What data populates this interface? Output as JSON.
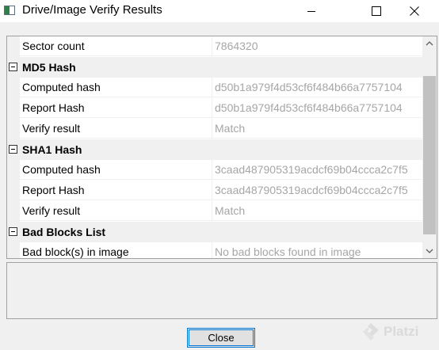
{
  "window": {
    "title": "Drive/Image Verify Results"
  },
  "rows": [
    {
      "kind": "property",
      "name": "Sector count",
      "value": "7864320"
    },
    {
      "kind": "category",
      "name": "MD5 Hash"
    },
    {
      "kind": "property",
      "name": "Computed hash",
      "value": "d50b1a979f4d53cf6f484b66a7757104"
    },
    {
      "kind": "property",
      "name": "Report Hash",
      "value": "d50b1a979f4d53cf6f484b66a7757104"
    },
    {
      "kind": "property",
      "name": "Verify result",
      "value": "Match"
    },
    {
      "kind": "category",
      "name": "SHA1 Hash"
    },
    {
      "kind": "property",
      "name": "Computed hash",
      "value": "3caad487905319acdcf69b04ccca2c7f5"
    },
    {
      "kind": "property",
      "name": "Report Hash",
      "value": "3caad487905319acdcf69b04ccca2c7f5"
    },
    {
      "kind": "property",
      "name": "Verify result",
      "value": "Match"
    },
    {
      "kind": "category",
      "name": "Bad Blocks List"
    },
    {
      "kind": "property",
      "name": "Bad block(s) in image",
      "value": "No bad blocks found in image"
    }
  ],
  "footer": {
    "close_label": "Close"
  },
  "watermark": {
    "text": "Platzi"
  },
  "colors": {
    "value_text": "#a6a6a6",
    "button_border": "#0078d7",
    "category_bg": "#f0f0f0"
  },
  "icons": {
    "app": "drive-image-app-icon",
    "minimize": "minimize-icon",
    "maximize": "maximize-icon",
    "close": "close-icon",
    "expander": "collapse-minus-icon",
    "scroll_up": "chevron-up-icon",
    "scroll_down": "chevron-down-icon"
  }
}
